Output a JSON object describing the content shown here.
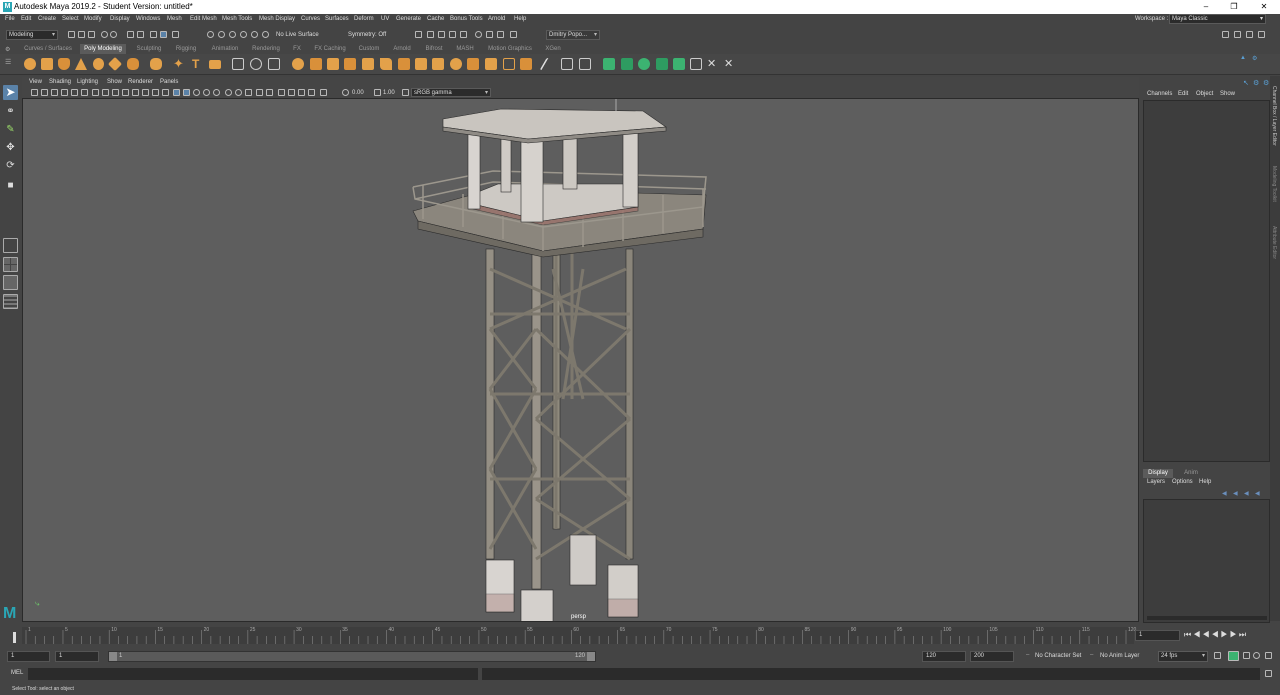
{
  "window": {
    "title": "Autodesk Maya 2019.2 - Student Version: untitled*",
    "logo": "M"
  },
  "menubar": {
    "items": [
      "File",
      "Edit",
      "Create",
      "Select",
      "Modify",
      "Display",
      "Windows",
      "Mesh",
      "Edit Mesh",
      "Mesh Tools",
      "Mesh Display",
      "Curves",
      "Surfaces",
      "Deform",
      "UV",
      "Generate",
      "Cache",
      "Bonus Tools",
      "Arnold",
      "Help"
    ],
    "workspace_label": "Workspace :",
    "workspace_value": "Maya Classic"
  },
  "toolbar": {
    "mode": "Modeling",
    "live_surface": "No Live Surface",
    "symmetry": "Symmetry: Off",
    "user": "Dmitry Popo..."
  },
  "shelf_tabs": [
    "Curves / Surfaces",
    "Poly Modeling",
    "Sculpting",
    "Rigging",
    "Animation",
    "Rendering",
    "FX",
    "FX Caching",
    "Custom",
    "Arnold",
    "Bifrost",
    "MASH",
    "Motion Graphics",
    "XGen"
  ],
  "shelf_active": "Poly Modeling",
  "viewport": {
    "menu": [
      "View",
      "Shading",
      "Lighting",
      "Show",
      "Renderer",
      "Panels"
    ],
    "exposure": "0.00",
    "gamma": "1.00",
    "color_space": "sRGB gamma",
    "camera_label": "persp"
  },
  "channel_box": {
    "menu": [
      "Channels",
      "Edit",
      "Object",
      "Show"
    ]
  },
  "layer_editor": {
    "tabs": [
      "Display",
      "Anim"
    ],
    "menu": [
      "Layers",
      "Options",
      "Help"
    ]
  },
  "side_tabs": [
    "Channel Box / Layer Editor",
    "Modeling Toolkit",
    "Attribute Editor"
  ],
  "timeline": {
    "ticks": [
      "1",
      "5",
      "10",
      "15",
      "20",
      "25",
      "30",
      "35",
      "40",
      "45",
      "50",
      "55",
      "60",
      "65",
      "70",
      "75",
      "80",
      "85",
      "90",
      "95",
      "100",
      "105",
      "110",
      "115",
      "120"
    ],
    "current_frame": "1"
  },
  "range": {
    "start": "1",
    "playback_start": "1",
    "slider_start": "1",
    "slider_end": "120",
    "playback_end": "120",
    "end": "200",
    "character_set": "No Character Set",
    "anim_layer": "No Anim Layer",
    "fps": "24 fps"
  },
  "command": {
    "label": "MEL",
    "help_text": "Select Tool: select an object"
  },
  "colors": {
    "accent_orange": "#e3a14a",
    "active_tab": "#5b5b5b",
    "maya_teal": "#2aa6b5",
    "green_shelf": "#3cb371"
  }
}
